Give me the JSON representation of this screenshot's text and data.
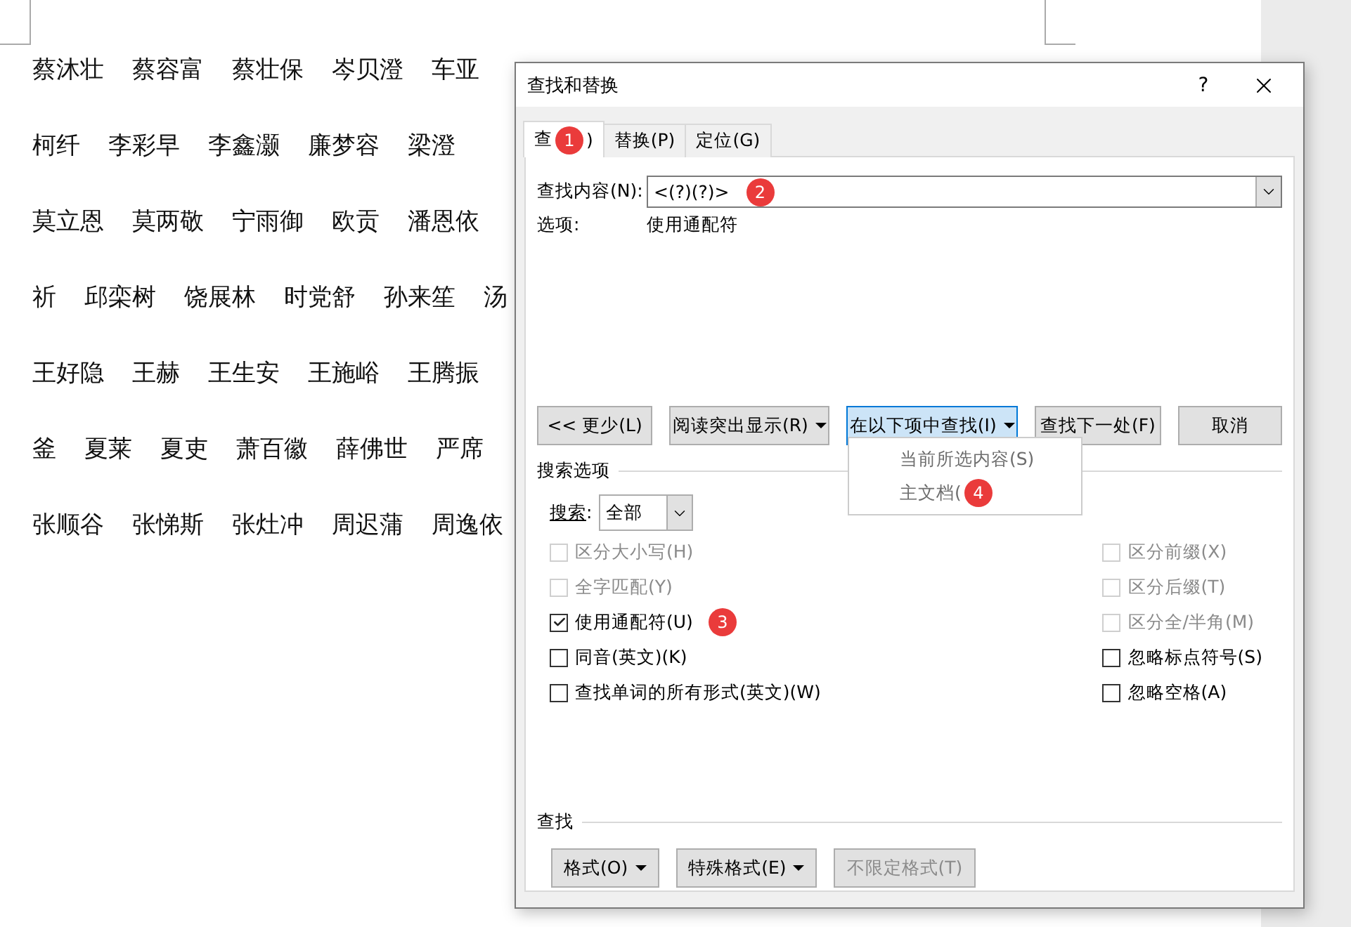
{
  "document": {
    "lines": [
      [
        "蔡沐壮",
        "蔡容富",
        "蔡壮保",
        "岑贝澄",
        "车亚"
      ],
      [
        "柯纤",
        "李彩早",
        "李鑫灏",
        "廉梦容",
        "梁澄"
      ],
      [
        "莫立恩",
        "莫两敬",
        "宁雨御",
        "欧贡",
        "潘恩依"
      ],
      [
        "祈",
        "邱栾树",
        "饶展林",
        "时党舒",
        "孙来笙",
        "汤"
      ],
      [
        "王好隐",
        "王赫",
        "王生安",
        "王施峪",
        "王腾振"
      ],
      [
        "釜",
        "夏莱",
        "夏吏",
        "萧百徽",
        "薛佛世",
        "严席"
      ],
      [
        "张顺谷",
        "张悌斯",
        "张灶冲",
        "周迟蒲",
        "周逸依"
      ]
    ]
  },
  "dialog": {
    "title": "查找和替换",
    "help": "?",
    "tabs": [
      {
        "label": "查",
        "tail": ")",
        "badge": "1",
        "selected": true
      },
      {
        "label": "替换(P)",
        "selected": false
      },
      {
        "label": "定位(G)",
        "selected": false
      }
    ],
    "find": {
      "label": "查找内容(N):",
      "value": "<(?)(?)>",
      "badge": "2"
    },
    "options": {
      "label": "选项:",
      "value": "使用通配符"
    },
    "buttons": [
      {
        "label": "<< 更少(L)",
        "caret": false,
        "selected": false
      },
      {
        "label": "阅读突出显示(R)",
        "caret": true,
        "selected": false
      },
      {
        "label": "在以下项中查找(I)",
        "caret": true,
        "selected": true
      },
      {
        "label": "查找下一处(F)",
        "caret": false,
        "selected": false
      },
      {
        "label": "取消",
        "caret": false,
        "selected": false
      }
    ],
    "menu": [
      {
        "label": "当前所选内容(S)"
      },
      {
        "label": "主文档(",
        "badge": "4"
      }
    ],
    "search_options": {
      "title": "搜索选项",
      "search_label": "搜索:",
      "search_value": "全部",
      "left": [
        {
          "label": "区分大小写(H)",
          "checked": false,
          "disabled": true
        },
        {
          "label": "全字匹配(Y)",
          "checked": false,
          "disabled": true
        },
        {
          "label": "使用通配符(U)",
          "checked": true,
          "disabled": false,
          "badge": "3"
        },
        {
          "label": "同音(英文)(K)",
          "checked": false,
          "disabled": false
        },
        {
          "label": "查找单词的所有形式(英文)(W)",
          "checked": false,
          "disabled": false
        }
      ],
      "right": [
        {
          "label": "区分前缀(X)",
          "checked": false,
          "disabled": true
        },
        {
          "label": "区分后缀(T)",
          "checked": false,
          "disabled": true
        },
        {
          "label": "区分全/半角(M)",
          "checked": false,
          "disabled": true
        },
        {
          "label": "忽略标点符号(S)",
          "checked": false,
          "disabled": false
        },
        {
          "label": "忽略空格(A)",
          "checked": false,
          "disabled": false
        }
      ]
    },
    "find_section": {
      "title": "查找",
      "buttons": [
        {
          "label": "格式(O)",
          "caret": true,
          "disabled": false
        },
        {
          "label": "特殊格式(E)",
          "caret": true,
          "disabled": false
        },
        {
          "label": "不限定格式(T)",
          "caret": false,
          "disabled": true
        }
      ]
    }
  }
}
